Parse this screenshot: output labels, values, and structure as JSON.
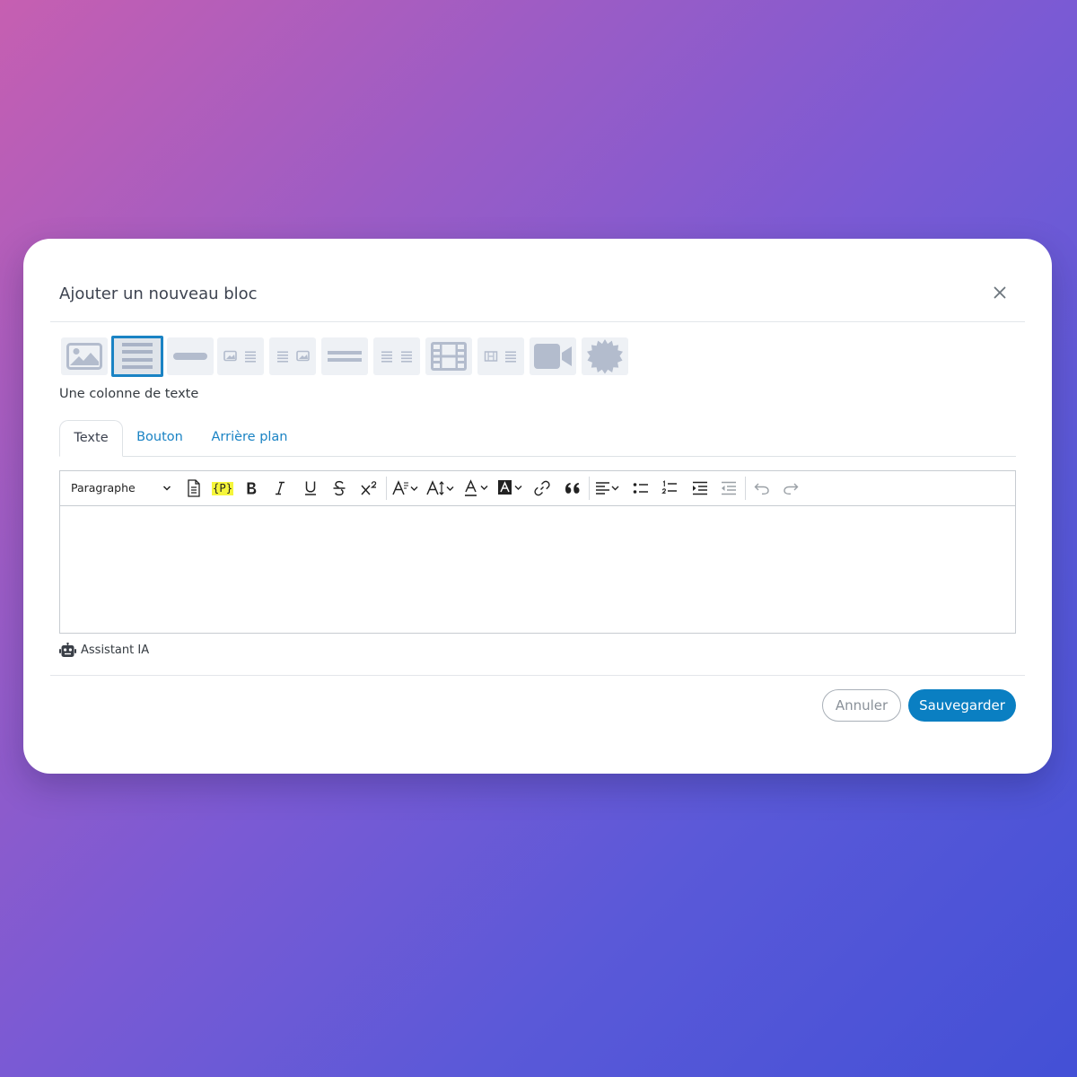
{
  "modal": {
    "title": "Ajouter un nouveau bloc",
    "close_icon": "close-icon"
  },
  "block_types": {
    "selected_index": 1,
    "selected_label": "Une colonne de texte",
    "items": [
      {
        "icon": "image-icon"
      },
      {
        "icon": "text-column-icon"
      },
      {
        "icon": "separator-icon"
      },
      {
        "icon": "image-left-text-right-icon"
      },
      {
        "icon": "text-left-image-right-icon"
      },
      {
        "icon": "double-line-separator-icon"
      },
      {
        "icon": "two-text-columns-icon"
      },
      {
        "icon": "film-icon"
      },
      {
        "icon": "video-left-text-right-icon"
      },
      {
        "icon": "video-camera-icon"
      },
      {
        "icon": "badge-icon"
      }
    ]
  },
  "tabs": [
    {
      "label": "Texte",
      "active": true
    },
    {
      "label": "Bouton",
      "active": false
    },
    {
      "label": "Arrière plan",
      "active": false
    }
  ],
  "toolbar": {
    "paragraph_select": "Paragraphe",
    "variable_tag": "{P}"
  },
  "ai_assistant": {
    "label": "Assistant IA"
  },
  "actions": {
    "cancel_label": "Annuler",
    "save_label": "Sauvegarder"
  },
  "colors": {
    "accent": "#0a7fc2",
    "tab_link": "#1a83c4",
    "block_icon": "#b3bccd",
    "variable_highlight": "#f5f53a"
  }
}
